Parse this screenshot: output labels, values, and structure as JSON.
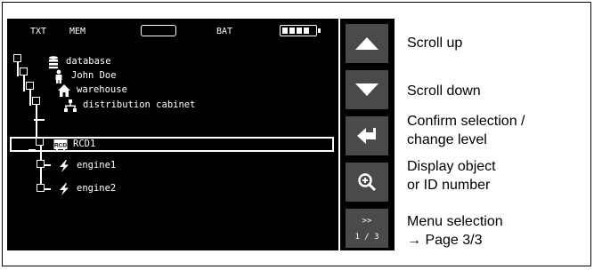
{
  "status": {
    "txt": "TXT",
    "mem": "MEM",
    "bat": "BAT"
  },
  "tree": {
    "items": [
      {
        "label": "database",
        "icon": "database-icon"
      },
      {
        "label": "John Doe",
        "icon": "person-icon"
      },
      {
        "label": "warehouse",
        "icon": "house-icon"
      },
      {
        "label": "distribution cabinet",
        "icon": "network-icon"
      },
      {
        "label": "RCD1",
        "icon": "rcd-icon",
        "badge": "RCD",
        "selected": true
      },
      {
        "label": "engine1",
        "icon": "lightning-icon"
      },
      {
        "label": "engine2",
        "icon": "lightning-icon"
      }
    ]
  },
  "sidebar": {
    "page_arrow": ">>",
    "page_number": "1 / 3"
  },
  "descriptions": {
    "scroll_up": "Scroll up",
    "scroll_down": "Scroll down",
    "confirm_line1": "Confirm selection /",
    "confirm_line2": "change level",
    "display_line1": "Display object",
    "display_line2": "or ID number",
    "menu_line1": "Menu selection",
    "menu_line2": "→ Page 3/3"
  },
  "colors": {
    "screen": "#000000",
    "button": "#4a4a4a",
    "foreground": "#ffffff"
  }
}
